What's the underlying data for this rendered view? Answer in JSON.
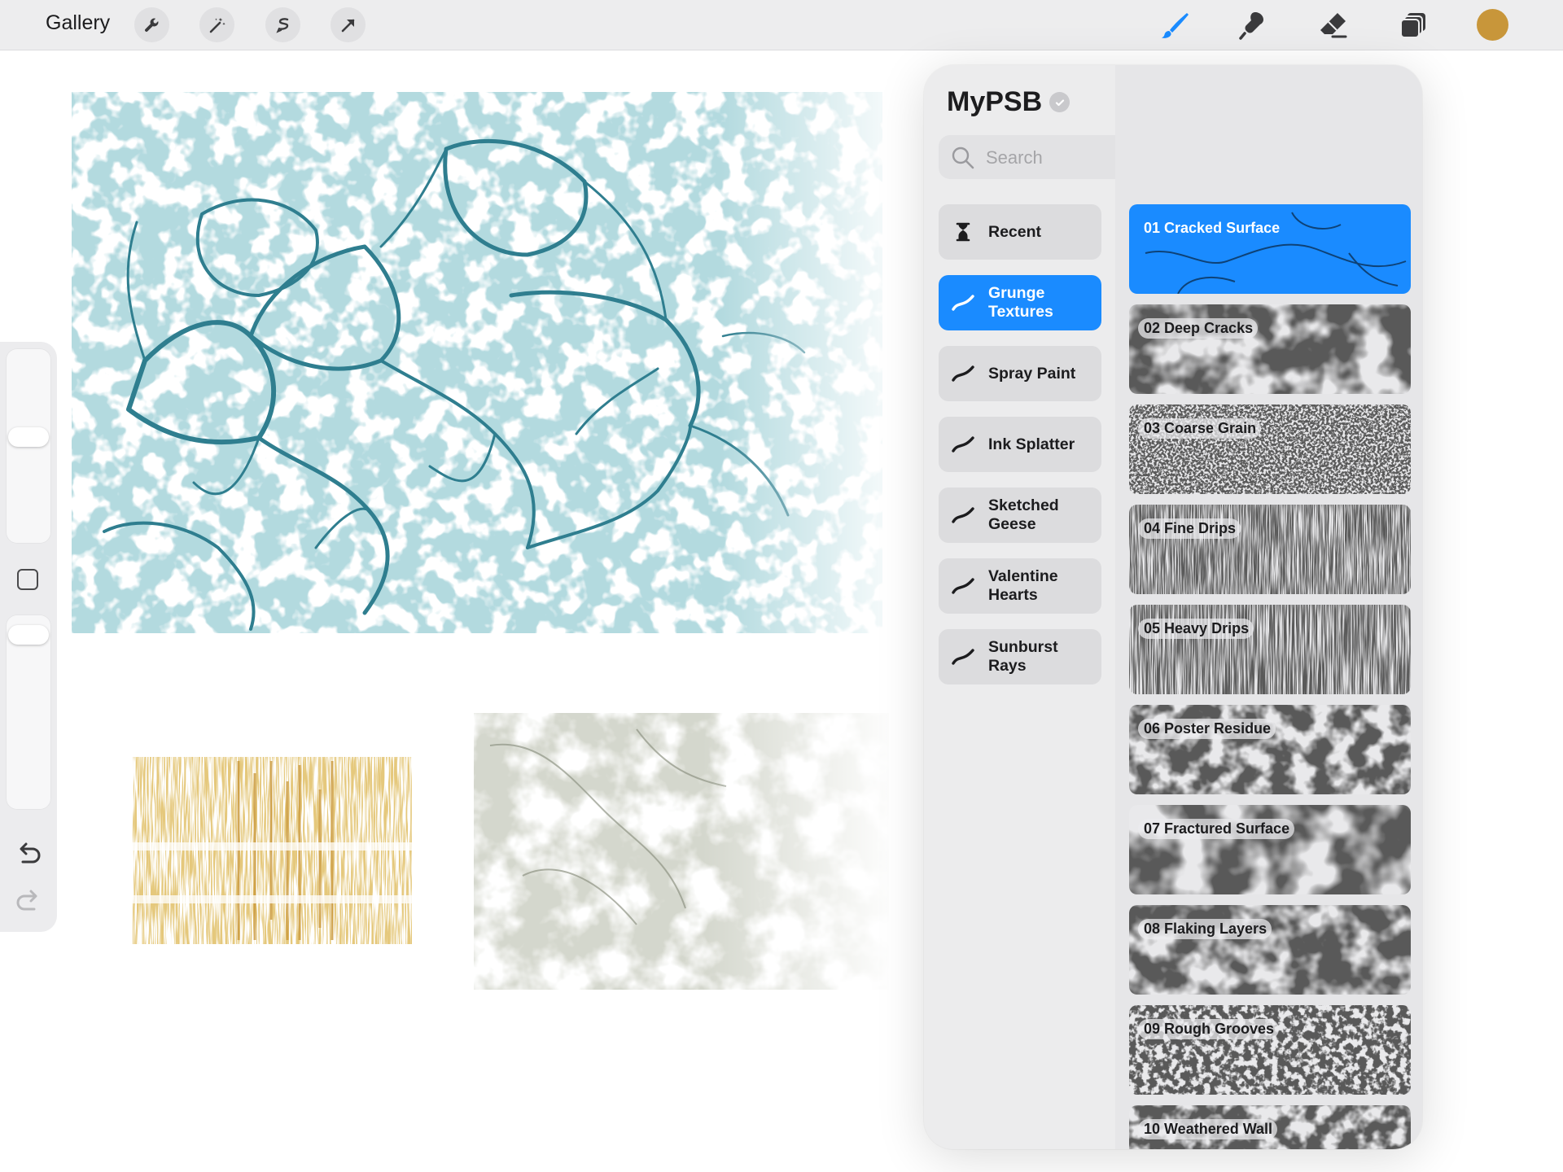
{
  "topbar": {
    "gallery_label": "Gallery",
    "left_tools": [
      "wrench-icon",
      "magic-wand-icon",
      "selection-icon",
      "transform-arrow-icon"
    ],
    "right_tools": [
      "brush-icon",
      "smudge-icon",
      "eraser-icon",
      "layers-icon"
    ],
    "current_color": "#C8963A"
  },
  "sidebar": {
    "brush_size_level": 0.55,
    "opacity_level": 0.94,
    "modifier_icon": "square-modifier-icon",
    "undo_icon": "undo-icon",
    "redo_icon": "redo-icon"
  },
  "canvas": {
    "artworks": [
      "cracked-texture-teal",
      "scratch-texture-gold",
      "flaking-texture-sage"
    ],
    "colors": {
      "teal": "#2F7E8F",
      "gold": "#C89434",
      "sage": "#A8AE9C"
    }
  },
  "library": {
    "title": "MyPSB",
    "search": {
      "placeholder": "Search",
      "value": ""
    },
    "accent": "#1A8BFF",
    "categories": [
      {
        "label": "Recent",
        "icon": "hourglass-icon"
      },
      {
        "label": "Grunge Textures",
        "icon": "brush-stroke-icon",
        "active": true
      },
      {
        "label": "Spray Paint",
        "icon": "brush-stroke-icon"
      },
      {
        "label": "Ink Splatter",
        "icon": "brush-stroke-icon"
      },
      {
        "label": "Sketched Geese",
        "icon": "brush-stroke-icon"
      },
      {
        "label": "Valentine Hearts",
        "icon": "brush-stroke-icon"
      },
      {
        "label": "Sunburst Rays",
        "icon": "brush-stroke-icon"
      }
    ],
    "brushes": [
      {
        "label": "01 Cracked Surface",
        "active": true
      },
      {
        "label": "02 Deep Cracks"
      },
      {
        "label": "03 Coarse Grain"
      },
      {
        "label": "04 Fine Drips"
      },
      {
        "label": "05 Heavy Drips"
      },
      {
        "label": "06 Poster Residue"
      },
      {
        "label": "07 Fractured Surface"
      },
      {
        "label": "08 Flaking Layers"
      },
      {
        "label": "09 Rough Grooves"
      },
      {
        "label": "10 Weathered Wall"
      }
    ]
  }
}
